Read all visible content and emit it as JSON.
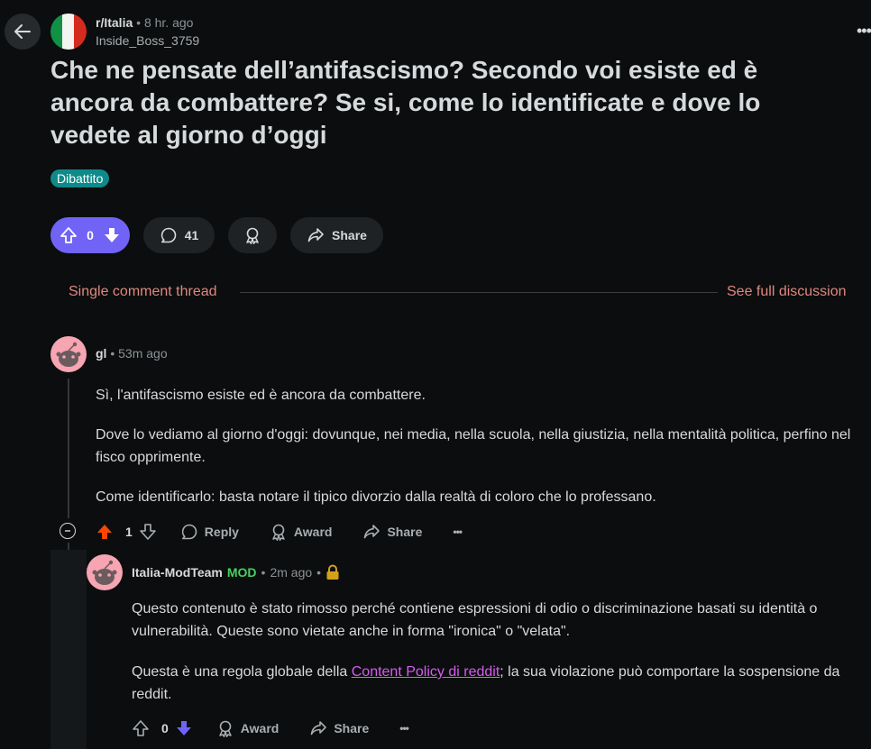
{
  "post": {
    "subreddit": "r/Italia",
    "separator": "•",
    "time": "8 hr. ago",
    "author": "Inside_Boss_3759",
    "title": "Che ne pensate dell’antifascismo? Secondo voi esiste ed è ancora da combattere? Se si, come lo identificate e dove lo vedete al giorno d’oggi",
    "flair": "Dibattito",
    "vote_count": "0",
    "comment_count": "41",
    "share_label": "Share",
    "more": "•••"
  },
  "thread": {
    "single_label": "Single comment thread",
    "full_label": "See full discussion"
  },
  "comments": [
    {
      "author": "gl",
      "separator": "•",
      "time": "53m ago",
      "paragraphs": [
        "Sì, l'antifascismo esiste ed è ancora da combattere.",
        "Dove lo vediamo al giorno d'oggi: dovunque, nei media, nella scuola, nella giustizia, nella mentalità politica, perfino nel fisco opprimente.",
        "Come identificarlo: basta notare il tipico divorzio dalla realtà di coloro che lo professano."
      ],
      "score": "1",
      "reply_label": "Reply",
      "award_label": "Award",
      "share_label": "Share",
      "more": "•••"
    },
    {
      "author": "Italia-ModTeam",
      "mod_tag": "MOD",
      "separator": "•",
      "time": "2m ago",
      "separator2": "•",
      "paragraphs": [
        "Questo contenuto è stato rimosso perché contiene espressioni di odio o discriminazione basati su identità o vulnerabilità. Queste sono vietate anche in forma \"ironica\" o \"velata\"."
      ],
      "p2_before": "Questa è una regola globale della ",
      "p2_link": "Content Policy di reddit",
      "p2_after": "; la sua violazione può comportare la sospensione da reddit.",
      "score": "0",
      "award_label": "Award",
      "share_label": "Share",
      "more": "•••"
    }
  ],
  "colors": {
    "background": "#0b0d0e",
    "upvote_active": "#7063f6",
    "comment_upvoted": "#ff4500",
    "link_accent": "#e0887f",
    "flair": "#0e8a8a",
    "mod_green": "#46d160",
    "lock": "#d4a017"
  },
  "icons": [
    "back-arrow-icon",
    "italy-flag-icon",
    "upvote-icon",
    "downvote-icon",
    "comment-icon",
    "award-icon",
    "share-icon",
    "collapse-icon",
    "reply-icon",
    "lock-icon",
    "snoo-avatar-icon"
  ]
}
